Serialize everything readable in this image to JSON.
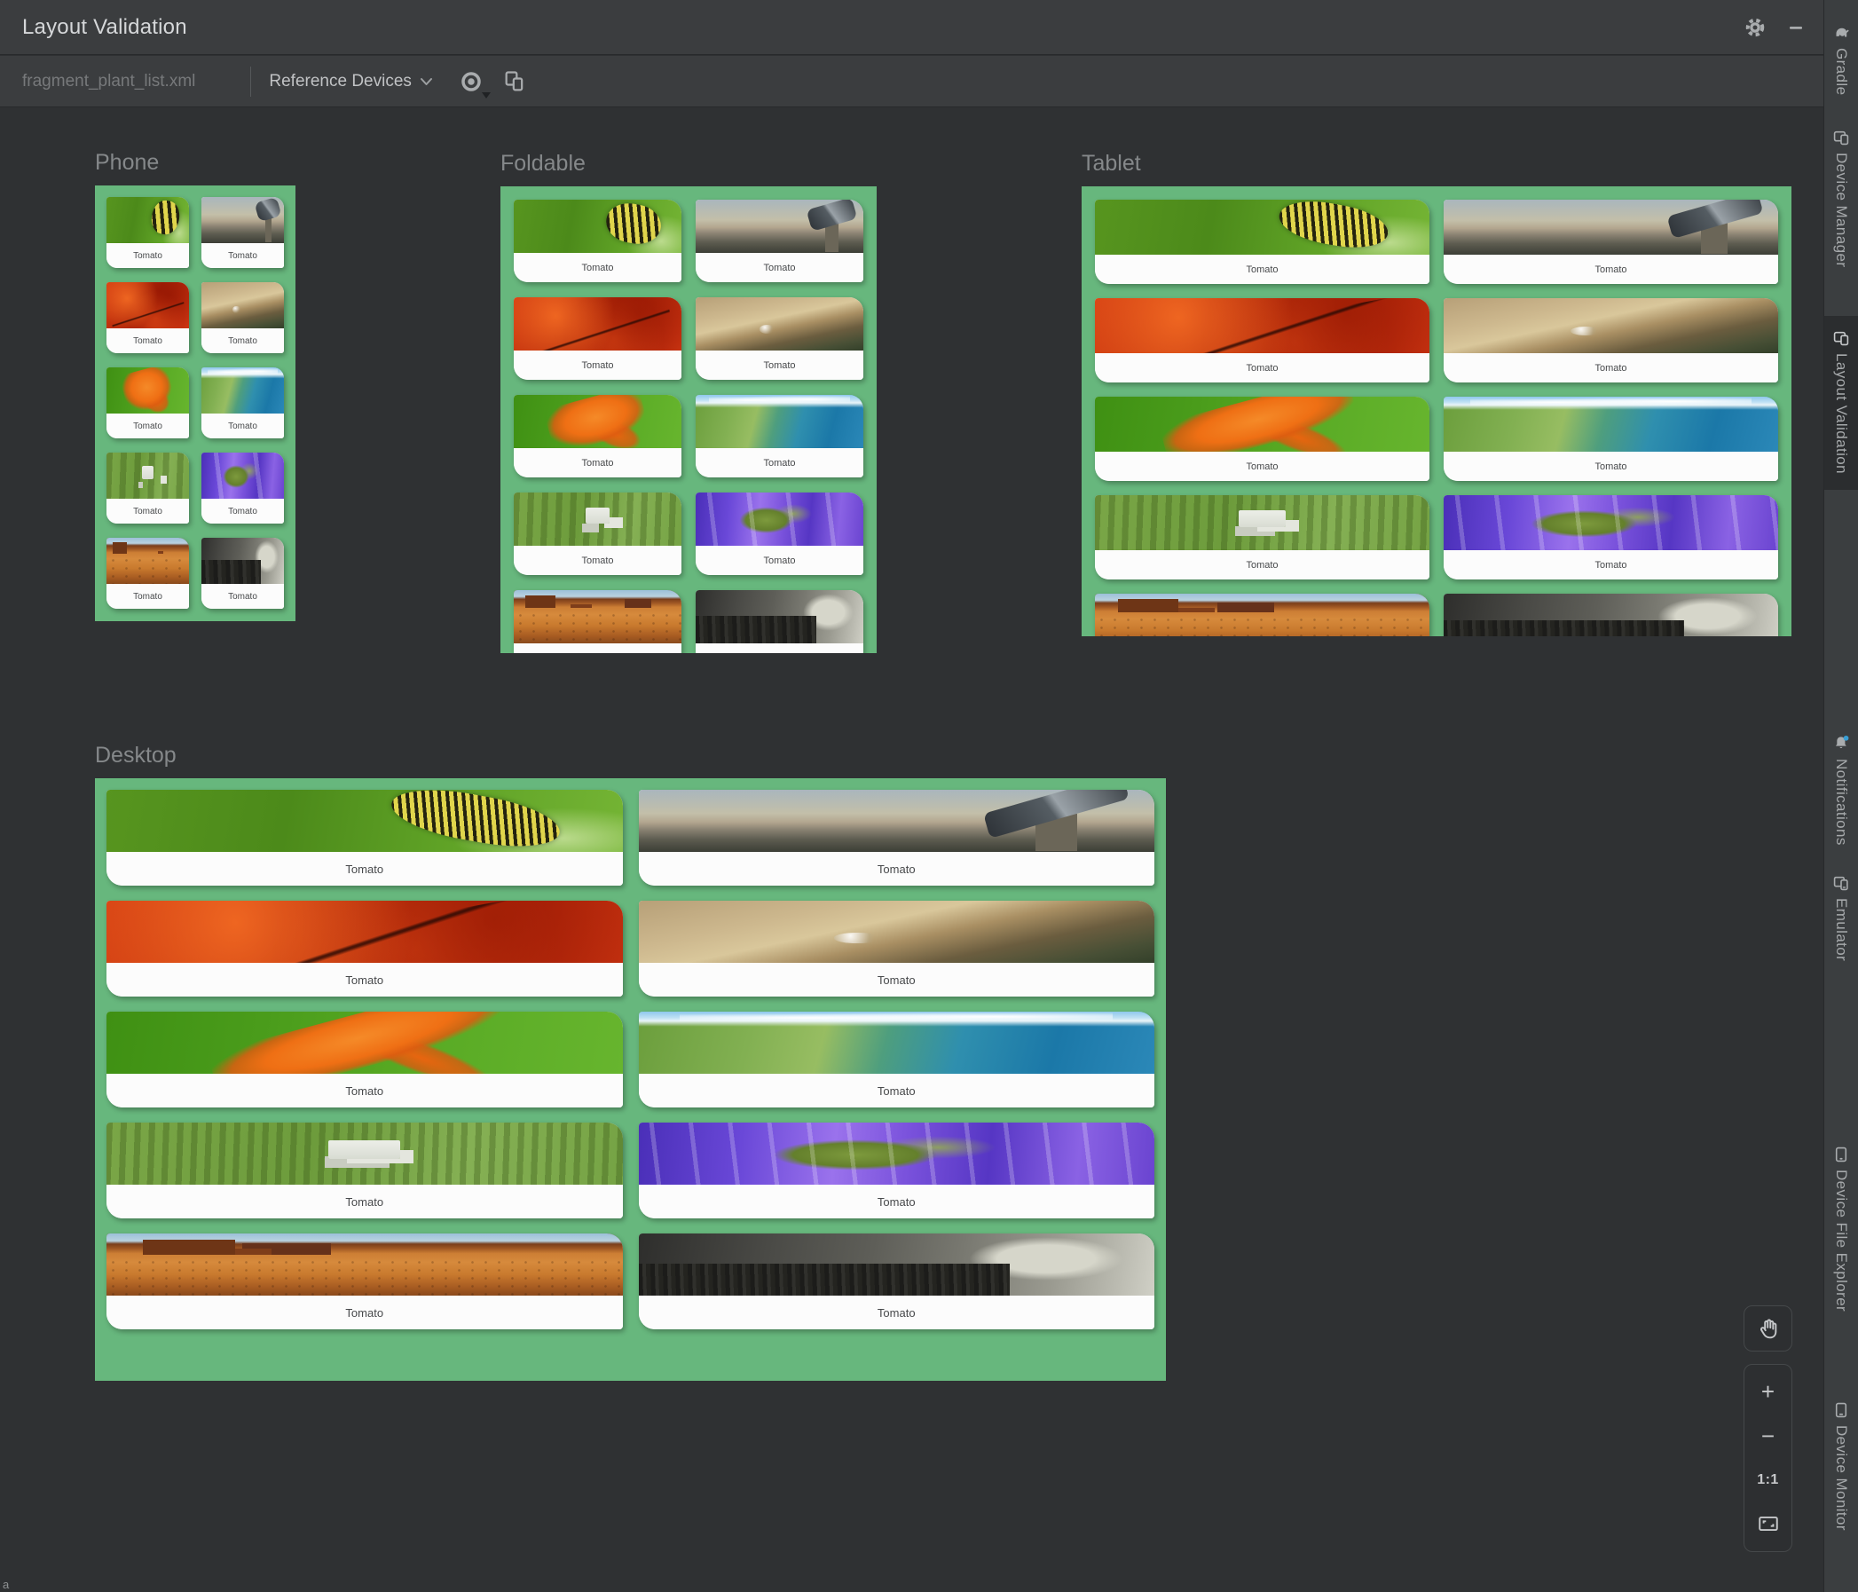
{
  "window": {
    "title": "Layout Validation"
  },
  "toolbar": {
    "file_name": "fragment_plant_list.xml",
    "device_set_selector": "Reference Devices",
    "actions": [
      "visibility-icon",
      "copy-configuration-icon"
    ]
  },
  "sidebar": {
    "items": [
      {
        "label": "Gradle",
        "icon": "gradle-elephant-icon",
        "selected": false
      },
      {
        "label": "Device Manager",
        "icon": "device-manager-icon",
        "selected": false
      },
      {
        "label": "Layout Validation",
        "icon": "layout-validation-icon",
        "selected": true
      },
      {
        "label": "Notifications",
        "icon": "notifications-bell-icon",
        "selected": false,
        "has_badge": true
      },
      {
        "label": "Emulator",
        "icon": "emulator-icon",
        "selected": false
      },
      {
        "label": "Device File Explorer",
        "icon": "device-file-explorer-icon",
        "selected": false
      },
      {
        "label": "Device Monitor",
        "icon": "device-monitor-icon",
        "selected": false
      }
    ]
  },
  "canvas": {
    "sections": [
      {
        "name": "Phone"
      },
      {
        "name": "Foldable"
      },
      {
        "name": "Tablet"
      },
      {
        "name": "Desktop"
      }
    ],
    "cards": [
      {
        "label": "Tomato",
        "image": "caterpillar-leaf"
      },
      {
        "label": "Tomato",
        "image": "telescope-city"
      },
      {
        "label": "Tomato",
        "image": "red-maple-leaves"
      },
      {
        "label": "Tomato",
        "image": "wood-beam-drops"
      },
      {
        "label": "Tomato",
        "image": "orange-maple-leaf"
      },
      {
        "label": "Tomato",
        "image": "coast-aerial"
      },
      {
        "label": "Tomato",
        "image": "farm-aerial"
      },
      {
        "label": "Tomato",
        "image": "purple-river"
      },
      {
        "label": "Tomato",
        "image": "desert-plain"
      },
      {
        "label": "Tomato",
        "image": "forest-grayscale"
      }
    ]
  },
  "zoom_controls": {
    "pan": "pan-hand-icon",
    "zoom_in_label": "+",
    "zoom_out_label": "−",
    "actual_size_label": "1:1",
    "fit": "fit-to-screen-icon"
  },
  "status_corner_text": "a",
  "colors": {
    "preview_background_green": "#67B77D",
    "chrome_background": "#3B3D3F",
    "canvas_background": "#2F3133",
    "selected_tab_background": "#2B2D2F",
    "notification_badge_blue": "#389FD6",
    "card_surface": "#FCFCFC"
  }
}
